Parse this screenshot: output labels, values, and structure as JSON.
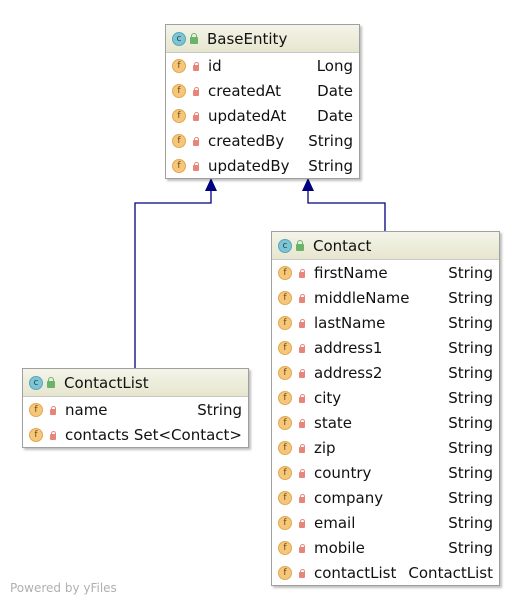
{
  "diagram": {
    "edge_color": "#000080",
    "classes": [
      {
        "id": "base",
        "name": "BaseEntity",
        "icon": "class-icon",
        "fields": [
          {
            "name": "id",
            "type": "Long"
          },
          {
            "name": "createdAt",
            "type": "Date"
          },
          {
            "name": "updatedAt",
            "type": "Date"
          },
          {
            "name": "createdBy",
            "type": "String"
          },
          {
            "name": "updatedBy",
            "type": "String"
          }
        ]
      },
      {
        "id": "contact",
        "name": "Contact",
        "icon": "class-icon",
        "fields": [
          {
            "name": "firstName",
            "type": "String"
          },
          {
            "name": "middleName",
            "type": "String"
          },
          {
            "name": "lastName",
            "type": "String"
          },
          {
            "name": "address1",
            "type": "String"
          },
          {
            "name": "address2",
            "type": "String"
          },
          {
            "name": "city",
            "type": "String"
          },
          {
            "name": "state",
            "type": "String"
          },
          {
            "name": "zip",
            "type": "String"
          },
          {
            "name": "country",
            "type": "String"
          },
          {
            "name": "company",
            "type": "String"
          },
          {
            "name": "email",
            "type": "String"
          },
          {
            "name": "mobile",
            "type": "String"
          },
          {
            "name": "contactList",
            "type": "ContactList"
          }
        ]
      },
      {
        "id": "contactlist",
        "name": "ContactList",
        "icon": "class-icon",
        "fields": [
          {
            "name": "name",
            "type": "String"
          },
          {
            "name": "contacts",
            "type": "Set<Contact>"
          }
        ]
      }
    ],
    "inheritance": [
      {
        "from": "ContactList",
        "to": "BaseEntity"
      },
      {
        "from": "Contact",
        "to": "BaseEntity"
      }
    ]
  },
  "watermark": "Powered by yFiles"
}
